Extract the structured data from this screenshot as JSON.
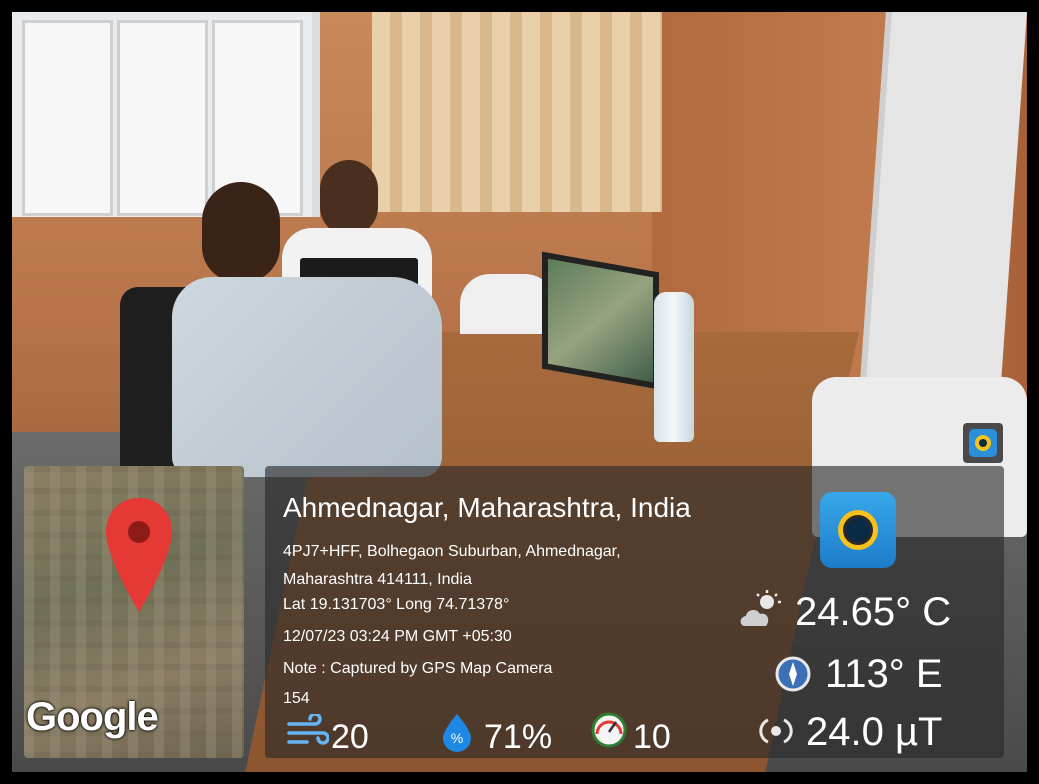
{
  "location": {
    "title": "Ahmednagar, Maharashtra, India",
    "address_line1": "4PJ7+HFF, Bolhegaon Suburban, Ahmednagar,",
    "address_line2": "Maharashtra 414111, India",
    "lat_long": "Lat 19.131703° Long 74.71378°",
    "datetime": "12/07/23 03:24 PM GMT +05:30",
    "note": "Note : Captured by GPS Map Camera",
    "altitude": "154"
  },
  "map": {
    "brand": "Google"
  },
  "weather": {
    "temperature": "24.65° C",
    "direction": "113° E",
    "magnetic": "24.0 µT",
    "wind": "20",
    "humidity": "71%",
    "pressure": "10"
  },
  "colors": {
    "panel_bg": "rgba(40,40,40,0.62)",
    "pin_red": "#e53935",
    "humidity_blue": "#1e88e5",
    "wind_blue": "#64b5f6"
  },
  "icons": {
    "map_pin": "map-pin-icon",
    "app": "gps-map-camera-app-icon",
    "weather": "partly-cloudy-icon",
    "compass": "compass-icon",
    "magnet": "magnetic-field-icon",
    "wind": "wind-icon",
    "humidity": "humidity-drop-icon",
    "pressure": "pressure-gauge-icon"
  }
}
